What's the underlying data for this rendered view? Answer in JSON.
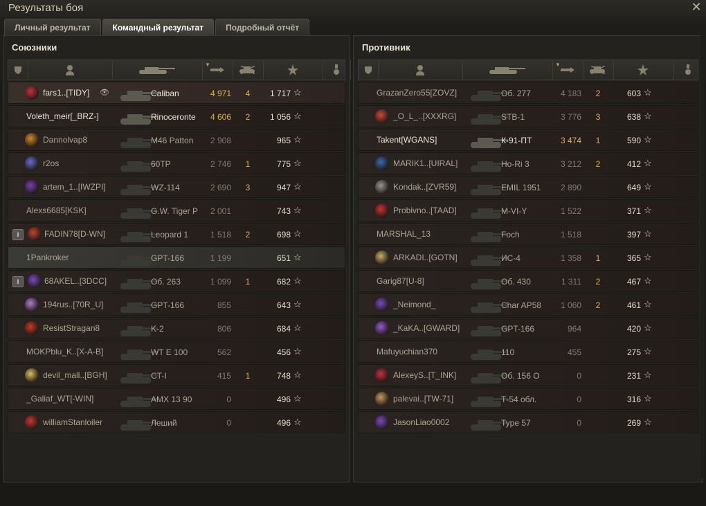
{
  "window": {
    "title": "Результаты боя",
    "close_icon": "close-icon"
  },
  "tabs": [
    {
      "label": "Личный результат",
      "active": false
    },
    {
      "label": "Командный результат",
      "active": true
    },
    {
      "label": "Подробный отчёт",
      "active": false
    }
  ],
  "columns": [
    "squad",
    "player",
    "tank",
    "damage",
    "kills",
    "experience",
    "medals"
  ],
  "allies": {
    "title": "Союзники",
    "rows": [
      {
        "squad": "",
        "player": "fars1..[TIDY]",
        "tank": "Caliban",
        "damage": "4 971",
        "kills": "4",
        "xp": "1 717",
        "alive": true,
        "state": "hl",
        "icon": "#c4323a",
        "eye": true,
        "dmgcolor": "gold"
      },
      {
        "squad": "",
        "player": "Voleth_meir[_BRZ-]",
        "tank": "Rinoceronte",
        "damage": "4 606",
        "kills": "2",
        "xp": "1 056",
        "alive": true,
        "state": "",
        "icon": "",
        "eye": false,
        "dmgcolor": "gold"
      },
      {
        "squad": "",
        "player": "Dannolvap8",
        "tank": "M46 Patton",
        "damage": "2 908",
        "kills": "",
        "xp": "965",
        "alive": false,
        "state": "",
        "icon": "#d48a2a",
        "eye": false,
        "dmgcolor": ""
      },
      {
        "squad": "",
        "player": "r2os",
        "tank": "60TP",
        "damage": "2 746",
        "kills": "1",
        "xp": "775",
        "alive": false,
        "state": "",
        "icon": "#6a6ad0",
        "eye": false,
        "dmgcolor": ""
      },
      {
        "squad": "",
        "player": "artem_1..[IWZPI]",
        "tank": "WZ-114",
        "damage": "2 690",
        "kills": "3",
        "xp": "947",
        "alive": false,
        "state": "",
        "icon": "#7a3fb0",
        "eye": false,
        "dmgcolor": ""
      },
      {
        "squad": "",
        "player": "Alexs6685[KSK]",
        "tank": "G.W. Tiger P",
        "damage": "2 001",
        "kills": "",
        "xp": "743",
        "alive": false,
        "state": "",
        "icon": "",
        "eye": false,
        "dmgcolor": ""
      },
      {
        "squad": "I",
        "player": "FADIN78[D-WN]",
        "tank": "Leopard 1",
        "damage": "1 518",
        "kills": "2",
        "xp": "698",
        "alive": false,
        "state": "",
        "icon": "#c0462e",
        "eye": false,
        "dmgcolor": ""
      },
      {
        "squad": "",
        "player": "1Pankroker",
        "tank": "GPT-166",
        "damage": "1 199",
        "kills": "",
        "xp": "651",
        "alive": false,
        "state": "me",
        "icon": "",
        "eye": false,
        "dmgcolor": ""
      },
      {
        "squad": "I",
        "player": "68AKEL..[3DCC]",
        "tank": "Об. 263",
        "damage": "1 099",
        "kills": "1",
        "xp": "682",
        "alive": false,
        "state": "",
        "icon": "#7a4ac0",
        "eye": false,
        "dmgcolor": ""
      },
      {
        "squad": "",
        "player": "194rus..[70R_U]",
        "tank": "GPT-166",
        "damage": "855",
        "kills": "",
        "xp": "643",
        "alive": false,
        "state": "",
        "icon": "#b07ad0",
        "eye": false,
        "dmgcolor": ""
      },
      {
        "squad": "",
        "player": "ResistStragan8",
        "tank": "K-2",
        "damage": "806",
        "kills": "",
        "xp": "684",
        "alive": false,
        "state": "",
        "icon": "#c83a2a",
        "eye": false,
        "dmgcolor": ""
      },
      {
        "squad": "",
        "player": "MOKPblu_K..[X-A-B]",
        "tank": "WT E 100",
        "damage": "562",
        "kills": "",
        "xp": "456",
        "alive": false,
        "state": "",
        "icon": "",
        "eye": false,
        "dmgcolor": ""
      },
      {
        "squad": "",
        "player": "devil_mall..[BGH]",
        "tank": "CT-I",
        "damage": "415",
        "kills": "1",
        "xp": "748",
        "alive": false,
        "state": "",
        "icon": "#d8c060",
        "eye": false,
        "dmgcolor": ""
      },
      {
        "squad": "",
        "player": "_Galiaf_WT[-WIN]",
        "tank": "AMX 13 90",
        "damage": "0",
        "kills": "",
        "xp": "496",
        "alive": false,
        "state": "",
        "icon": "",
        "eye": false,
        "dmgcolor": ""
      },
      {
        "squad": "",
        "player": "williamStanloiler",
        "tank": "Леший",
        "damage": "0",
        "kills": "",
        "xp": "496",
        "alive": false,
        "state": "",
        "icon": "#c83a2a",
        "eye": false,
        "dmgcolor": ""
      }
    ]
  },
  "enemies": {
    "title": "Противник",
    "rows": [
      {
        "squad": "",
        "player": "GrazanZero55[ZOVZ]",
        "tank": "Об. 277",
        "damage": "4 183",
        "kills": "2",
        "xp": "603",
        "alive": false,
        "state": "",
        "icon": "",
        "eye": false,
        "dmgcolor": ""
      },
      {
        "squad": "",
        "player": "_O_L_..[XXXRG]",
        "tank": "STB-1",
        "damage": "3 776",
        "kills": "3",
        "xp": "638",
        "alive": false,
        "state": "",
        "icon": "#d04a30",
        "eye": false,
        "dmgcolor": ""
      },
      {
        "squad": "",
        "player": "Takent[WGANS]",
        "tank": "К-91-ПТ",
        "damage": "3 474",
        "kills": "1",
        "xp": "590",
        "alive": true,
        "state": "",
        "icon": "",
        "eye": false,
        "dmgcolor": "gold"
      },
      {
        "squad": "",
        "player": "MARIK1..[UIRAL]",
        "tank": "Ho-Ri 3",
        "damage": "3 212",
        "kills": "2",
        "xp": "412",
        "alive": false,
        "state": "",
        "icon": "#3a6ab0",
        "eye": false,
        "dmgcolor": ""
      },
      {
        "squad": "",
        "player": "Kondak..[ZVR59]",
        "tank": "EMIL 1951",
        "damage": "2 890",
        "kills": "",
        "xp": "649",
        "alive": false,
        "state": "",
        "icon": "#9a9690",
        "eye": false,
        "dmgcolor": ""
      },
      {
        "squad": "",
        "player": "Probivno..[TAAD]",
        "tank": "M-VI-Y",
        "damage": "1 522",
        "kills": "",
        "xp": "371",
        "alive": false,
        "state": "",
        "icon": "#d03030",
        "eye": false,
        "dmgcolor": ""
      },
      {
        "squad": "",
        "player": "MARSHAL_13",
        "tank": "Foch",
        "damage": "1 518",
        "kills": "",
        "xp": "397",
        "alive": false,
        "state": "",
        "icon": "",
        "eye": false,
        "dmgcolor": ""
      },
      {
        "squad": "",
        "player": "ARKADI..[GOTN]",
        "tank": "ИС-4",
        "damage": "1 358",
        "kills": "1",
        "xp": "365",
        "alive": false,
        "state": "",
        "icon": "#c8b060",
        "eye": false,
        "dmgcolor": ""
      },
      {
        "squad": "",
        "player": "Garig87[U-8]",
        "tank": "Об. 430",
        "damage": "1 311",
        "kills": "2",
        "xp": "467",
        "alive": false,
        "state": "",
        "icon": "",
        "eye": false,
        "dmgcolor": ""
      },
      {
        "squad": "",
        "player": "_Neimond_",
        "tank": "Char AP58",
        "damage": "1 060",
        "kills": "2",
        "xp": "461",
        "alive": false,
        "state": "",
        "icon": "#7a4ac0",
        "eye": false,
        "dmgcolor": ""
      },
      {
        "squad": "",
        "player": "_KaKA..[GWARD]",
        "tank": "GPT-166",
        "damage": "964",
        "kills": "",
        "xp": "420",
        "alive": false,
        "state": "",
        "icon": "#9a5ad0",
        "eye": false,
        "dmgcolor": ""
      },
      {
        "squad": "",
        "player": "Mafuyuchian370",
        "tank": "110",
        "damage": "455",
        "kills": "",
        "xp": "275",
        "alive": false,
        "state": "",
        "icon": "",
        "eye": false,
        "dmgcolor": ""
      },
      {
        "squad": "",
        "player": "AlexeyS..[T_INK]",
        "tank": "Об. 156 О",
        "damage": "0",
        "kills": "",
        "xp": "231",
        "alive": false,
        "state": "",
        "icon": "#c4323a",
        "eye": false,
        "dmgcolor": ""
      },
      {
        "squad": "",
        "player": "palevai..[TW-71]",
        "tank": "Т-54 обл.",
        "damage": "0",
        "kills": "",
        "xp": "316",
        "alive": false,
        "state": "",
        "icon": "#c89a5a",
        "eye": false,
        "dmgcolor": ""
      },
      {
        "squad": "",
        "player": "JasonLiao0002",
        "tank": "Type 57",
        "damage": "0",
        "kills": "",
        "xp": "269",
        "alive": false,
        "state": "",
        "icon": "#7a4ac0",
        "eye": false,
        "dmgcolor": ""
      }
    ]
  },
  "star_glyph": "☆"
}
